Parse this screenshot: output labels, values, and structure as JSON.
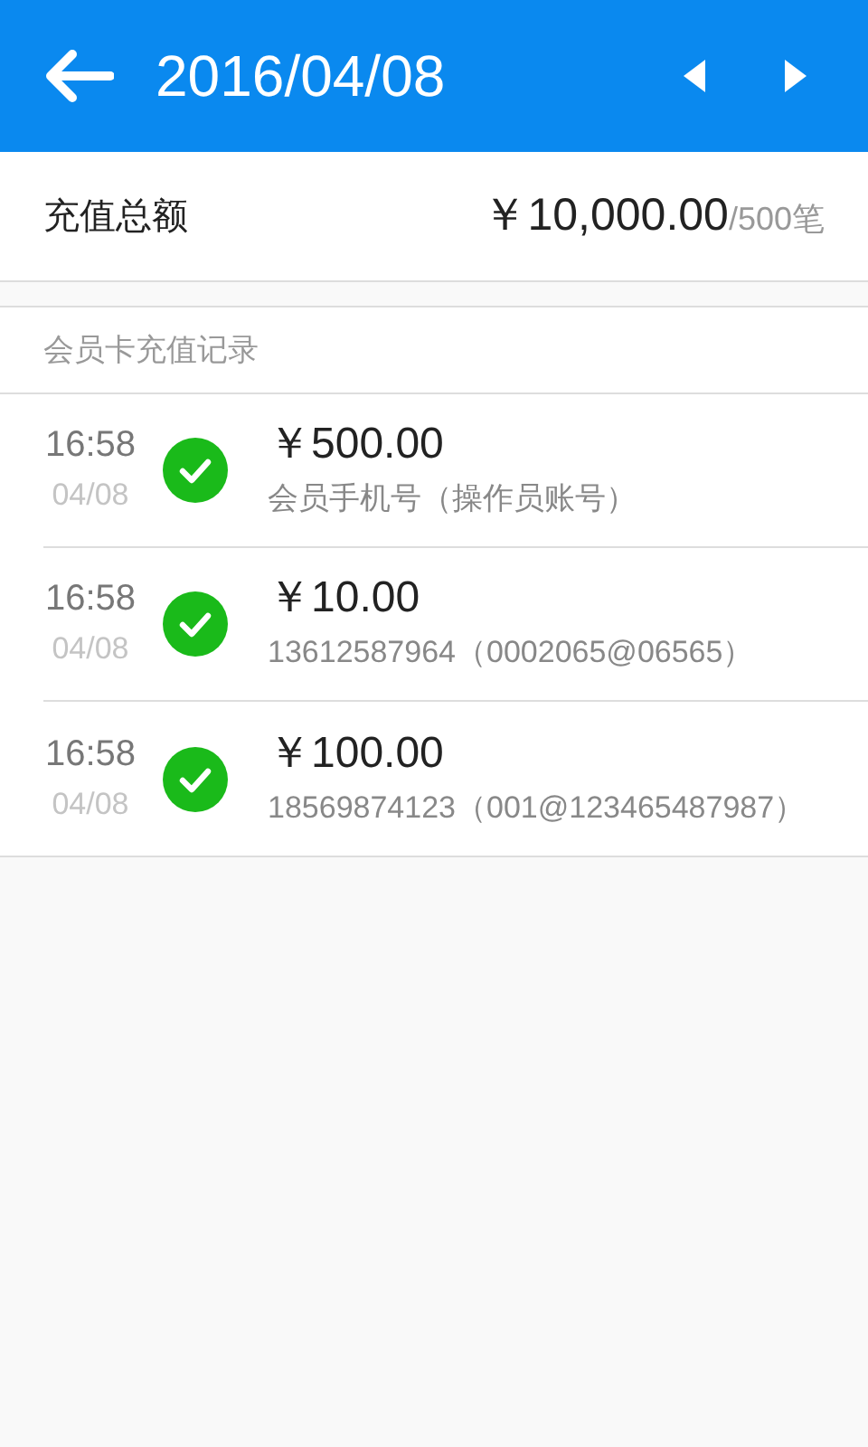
{
  "header": {
    "title": "2016/04/08"
  },
  "summary": {
    "label": "充值总额",
    "amount": "￥10,000.00",
    "count": "/500笔"
  },
  "section": {
    "title": "会员卡充值记录"
  },
  "records": [
    {
      "time": "16:58",
      "date": "04/08",
      "completed": true,
      "amount": "￥500.00",
      "detail": "会员手机号（操作员账号）"
    },
    {
      "time": "16:58",
      "date": "04/08",
      "completed": true,
      "amount": "￥10.00",
      "detail": "13612587964（0002065@06565）"
    },
    {
      "time": "16:58",
      "date": "04/08",
      "completed": true,
      "amount": "￥100.00",
      "detail": "18569874123（001@123465487987）"
    }
  ]
}
